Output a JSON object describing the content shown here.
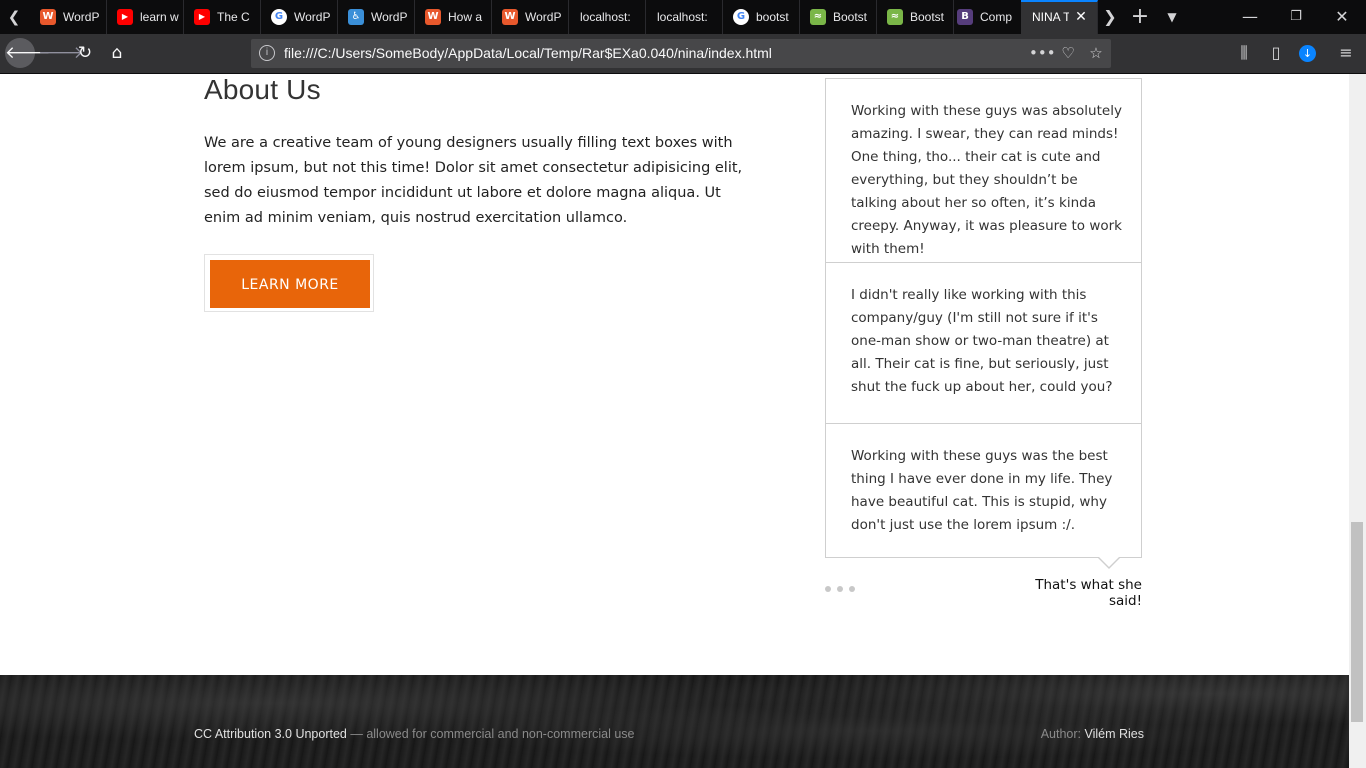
{
  "browser": {
    "tabs": [
      {
        "label": "WordP",
        "favicon": "wordpress-orange-icon",
        "color": "#e8582c",
        "glyph": "W"
      },
      {
        "label": "learn w",
        "favicon": "youtube-icon",
        "color": "#ff0000",
        "glyph": "▶"
      },
      {
        "label": "The C",
        "favicon": "youtube-icon",
        "color": "#ff0000",
        "glyph": "▶"
      },
      {
        "label": "WordP",
        "favicon": "google-icon",
        "color": "#ffffff",
        "glyph": "G"
      },
      {
        "label": "WordP",
        "favicon": "accessibility-icon",
        "color": "#3a8fd8",
        "glyph": "♿"
      },
      {
        "label": "How a",
        "favicon": "wordpress-orange-icon",
        "color": "#e8582c",
        "glyph": "W"
      },
      {
        "label": "WordP",
        "favicon": "wordpress-orange-icon",
        "color": "#e8582c",
        "glyph": "W"
      },
      {
        "label": "localhost:",
        "favicon": "",
        "color": "",
        "glyph": ""
      },
      {
        "label": "localhost:",
        "favicon": "",
        "color": "",
        "glyph": ""
      },
      {
        "label": "bootst",
        "favicon": "google-icon",
        "color": "#ffffff",
        "glyph": "G"
      },
      {
        "label": "Bootst",
        "favicon": "bootsnipp-icon",
        "color": "#7ab648",
        "glyph": "≈"
      },
      {
        "label": "Bootst",
        "favicon": "bootsnipp-icon",
        "color": "#7ab648",
        "glyph": "≈"
      },
      {
        "label": "Comp",
        "favicon": "bootstrap-icon",
        "color": "#563d7c",
        "glyph": "B"
      },
      {
        "label": "NINA T",
        "favicon": "",
        "color": "",
        "glyph": ""
      }
    ],
    "url": "file:///C:/Users/SomeBody/AppData/Local/Temp/Rar$EXa0.040/nina/index.html",
    "accent": "#0a84ff"
  },
  "about": {
    "title": "About Us",
    "text": "We are a creative team of young designers usually filling text boxes with lorem ipsum, but not this time! Dolor sit amet consectetur adipisicing elit, sed do eiusmod tempor incididunt ut labore et dolore magna aliqua. Ut enim ad minim veniam, quis nostrud exercitation ullamco.",
    "button_label": "LEARN MORE",
    "button_color": "#e8650a"
  },
  "testimonials": {
    "items": [
      "Working with these guys was absolutely amazing. I swear, they can read minds! One thing, tho... their cat is cute and everything, but they shouldn’t be talking about her so often, it’s kinda creepy. Anyway, it was pleasure to work with them!",
      "I didn't really like working with this company/guy (I'm still not sure if it's one-man show or two-man theatre) at all. Their cat is fine, but seriously, just shut the fuck up about her, could you?",
      "Working with these guys was the best thing I have ever done in my life. They have beautiful cat. This is stupid, why don't just use the lorem ipsum :/."
    ],
    "caption": "That's what she said!"
  },
  "footer": {
    "license": "CC Attribution 3.0 Unported",
    "license_note": " — allowed for commercial and non-commercial use",
    "author_label": "Author: ",
    "author_name": "Vilém Ries"
  }
}
